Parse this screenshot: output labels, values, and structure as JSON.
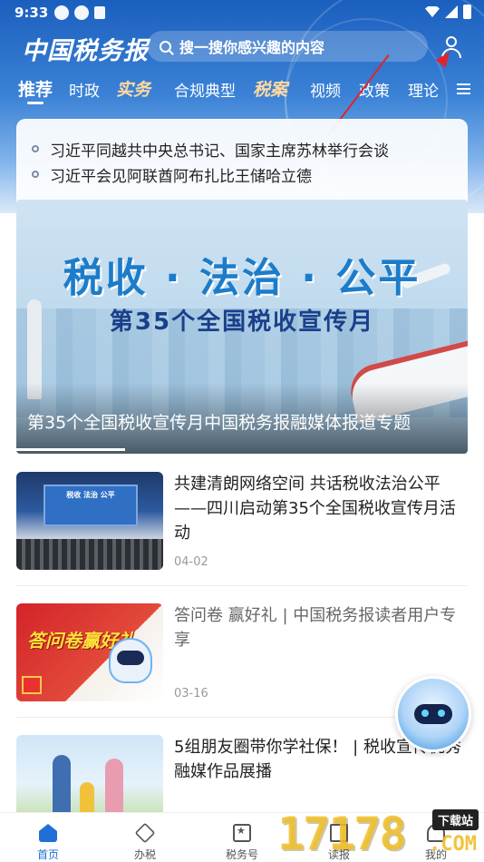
{
  "status_bar": {
    "time": "9:33"
  },
  "header": {
    "logo": "中国税务报",
    "search_placeholder": "搜一搜你感兴趣的内容"
  },
  "tabs": [
    {
      "label": "推荐",
      "active": true
    },
    {
      "label": "时政"
    },
    {
      "label": "实务"
    },
    {
      "label": "合规典型"
    },
    {
      "label": "税案"
    },
    {
      "label": "视频"
    },
    {
      "label": "政策"
    },
    {
      "label": "理论"
    }
  ],
  "ticker": [
    "习近平同越共中央总书记、国家主席苏林举行会谈",
    "习近平会见阿联酋阿布扎比王储哈立德"
  ],
  "banner": {
    "title_main": "税收 · 法治 · 公平",
    "title_sub": "第35个全国税收宣传月",
    "caption": "第35个全国税收宣传月中国税务报融媒体报道专题"
  },
  "articles": [
    {
      "title": "共建清朗网络空间 共话税收法治公平——四川启动第35个全国税收宣传月活动",
      "date": "04-02",
      "thumb_text": "税收 法治 公平"
    },
    {
      "title": "答问卷 赢好礼 | 中国税务报读者用户专享",
      "date": "03-16",
      "thumb_text": "答问卷赢好礼"
    },
    {
      "title": "5组朋友圈带你学社保！ | 税收宣传优秀融媒作品展播",
      "date": ""
    }
  ],
  "bottom_nav": [
    {
      "label": "首页",
      "icon": "home-icon",
      "active": true
    },
    {
      "label": "办税",
      "icon": "tax-icon"
    },
    {
      "label": "税务号",
      "icon": "star-badge-icon"
    },
    {
      "label": "读报",
      "icon": "newspaper-icon"
    },
    {
      "label": "我的",
      "icon": "user-icon"
    }
  ],
  "watermark": {
    "digits": "17178",
    "badge": "下载站",
    "suffix": ".COM"
  },
  "colors": {
    "primary": "#1f6fd6",
    "header_top": "#1b5fbe",
    "arrow": "#e0242a"
  }
}
